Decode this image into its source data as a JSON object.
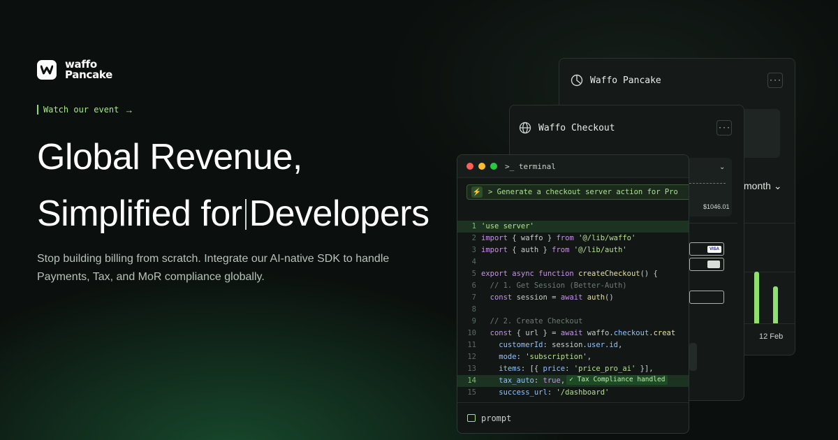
{
  "brand": {
    "line1": "waffo",
    "line2": "Pancake"
  },
  "event_link": "Watch our event",
  "headline": {
    "line1": "Global Revenue,",
    "line2_a": "Simplified for",
    "line2_b": "Developers"
  },
  "subtitle": "Stop building billing from scratch. Integrate our AI-native SDK to handle Payments, Tax, and MoR compliance globally.",
  "pancake_card": {
    "title": "Waffo Pancake",
    "more": "···",
    "period": "month",
    "date": "12 Feb",
    "bars": [
      0.62,
      0.44
    ]
  },
  "checkout_card": {
    "title": "Waffo Checkout",
    "more": "···",
    "amount": "$1046.01",
    "visa": "VISA"
  },
  "terminal": {
    "title": "terminal",
    "prompt": "> Generate a checkout server action for Pro",
    "badge": "✓ Tax Compliance handled",
    "footer": "prompt",
    "lines": [
      {
        "n": "1",
        "hl": true,
        "tokens": [
          [
            "str",
            "'use server'"
          ]
        ]
      },
      {
        "n": "2",
        "tokens": [
          [
            "kw",
            "import"
          ],
          [
            "src",
            " { waffo } "
          ],
          [
            "kw",
            "from"
          ],
          [
            "str",
            " '@/lib/waffo'"
          ]
        ]
      },
      {
        "n": "3",
        "tokens": [
          [
            "kw",
            "import"
          ],
          [
            "src",
            " { auth } "
          ],
          [
            "kw",
            "from"
          ],
          [
            "str",
            " '@/lib/auth'"
          ]
        ]
      },
      {
        "n": "4",
        "tokens": []
      },
      {
        "n": "5",
        "tokens": [
          [
            "kw",
            "export async function"
          ],
          [
            "fn",
            " createCheckout"
          ],
          [
            "src",
            "() {"
          ]
        ]
      },
      {
        "n": "6",
        "tokens": [
          [
            "cm",
            "  // 1. Get Session (Better-Auth)"
          ]
        ]
      },
      {
        "n": "7",
        "tokens": [
          [
            "kw",
            "  const"
          ],
          [
            "src",
            " session = "
          ],
          [
            "kw",
            "await"
          ],
          [
            "fn",
            " auth"
          ],
          [
            "src",
            "()"
          ]
        ]
      },
      {
        "n": "8",
        "tokens": []
      },
      {
        "n": "9",
        "tokens": [
          [
            "cm",
            "  // 2. Create Checkout"
          ]
        ]
      },
      {
        "n": "10",
        "tokens": [
          [
            "kw",
            "  const"
          ],
          [
            "src",
            " { url } = "
          ],
          [
            "kw",
            "await"
          ],
          [
            "src",
            " waffo."
          ],
          [
            "prop",
            "checkout"
          ],
          [
            "src",
            "."
          ],
          [
            "fn",
            "creat"
          ]
        ]
      },
      {
        "n": "11",
        "tokens": [
          [
            "prop",
            "    customerId"
          ],
          [
            "src",
            ": session."
          ],
          [
            "prop",
            "user"
          ],
          [
            "src",
            "."
          ],
          [
            "prop",
            "id"
          ],
          [
            "src",
            ","
          ]
        ]
      },
      {
        "n": "12",
        "tokens": [
          [
            "prop",
            "    mode"
          ],
          [
            "src",
            ": "
          ],
          [
            "str",
            "'subscription'"
          ],
          [
            "src",
            ","
          ]
        ]
      },
      {
        "n": "13",
        "tokens": [
          [
            "prop",
            "    items"
          ],
          [
            "src",
            ": [{ "
          ],
          [
            "prop",
            "price"
          ],
          [
            "src",
            ": "
          ],
          [
            "str",
            "'price_pro_ai'"
          ],
          [
            "src",
            " }],"
          ]
        ]
      },
      {
        "n": "14",
        "hl": true,
        "badge": true,
        "tokens": [
          [
            "prop",
            "    tax_auto"
          ],
          [
            "src",
            ": "
          ],
          [
            "kw",
            "true"
          ],
          [
            "src",
            ","
          ]
        ]
      },
      {
        "n": "15",
        "tokens": [
          [
            "prop",
            "    success_url"
          ],
          [
            "src",
            ": "
          ],
          [
            "str",
            "'/dashboard'"
          ]
        ]
      }
    ]
  },
  "colors": {
    "accent": "#8fe06d",
    "bg": "#0b0f0d"
  }
}
